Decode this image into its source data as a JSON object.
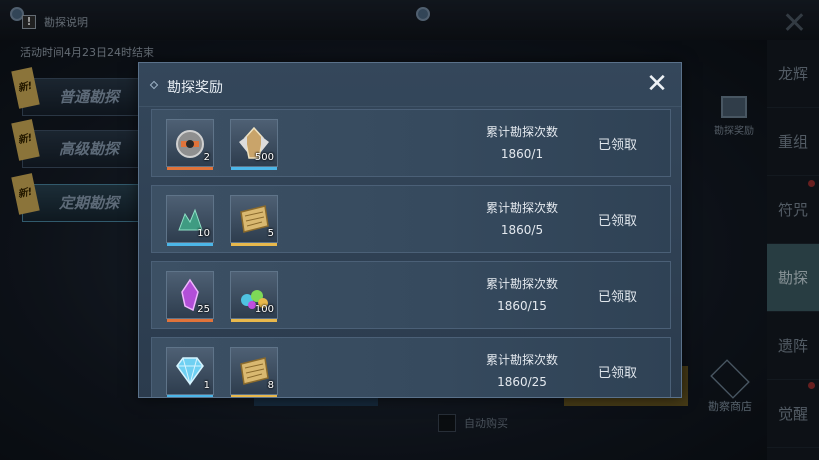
{
  "page": {
    "help_label": "勘探说明",
    "event_time": "活动时间4月23日24时结束",
    "modes": [
      {
        "new_tag": "新!",
        "label": "普通勘探"
      },
      {
        "new_tag": "新!",
        "label": "高级勘探"
      },
      {
        "new_tag": "新!",
        "label": "定期勘探"
      }
    ],
    "side_tabs": [
      "龙辉",
      "重组",
      "符咒",
      "勘探",
      "遗阵",
      "觉醒"
    ],
    "active_side_tab": "勘探",
    "reward_shortcut_label": "勘探奖励",
    "shop_label": "勘察商店",
    "auto_buy_label": "自动购买"
  },
  "modal": {
    "title": "勘探奖励",
    "close_icon": "close-icon",
    "rewards": [
      {
        "items": [
          {
            "icon": "mech-core-icon",
            "qty": "2",
            "rarity_color": "#e0733a"
          },
          {
            "icon": "armor-figure-icon",
            "qty": "500",
            "rarity_color": "#4cb6e8"
          }
        ],
        "condition_label": "累计勘探次数",
        "progress": "1860/1",
        "status": "已领取"
      },
      {
        "items": [
          {
            "icon": "green-crystal-icon",
            "qty": "10",
            "rarity_color": "#4cb6e8"
          },
          {
            "icon": "scroll-icon",
            "qty": "5",
            "rarity_color": "#e8b84c"
          }
        ],
        "condition_label": "累计勘探次数",
        "progress": "1860/5",
        "status": "已领取"
      },
      {
        "items": [
          {
            "icon": "purple-crystal-icon",
            "qty": "25",
            "rarity_color": "#e0733a"
          },
          {
            "icon": "gem-pile-icon",
            "qty": "100",
            "rarity_color": "#e8b84c"
          }
        ],
        "condition_label": "累计勘探次数",
        "progress": "1860/15",
        "status": "已领取"
      },
      {
        "items": [
          {
            "icon": "diamond-icon",
            "qty": "1",
            "rarity_color": "#4cb6e8"
          },
          {
            "icon": "scroll-icon",
            "qty": "8",
            "rarity_color": "#e8b84c"
          }
        ],
        "condition_label": "累计勘探次数",
        "progress": "1860/25",
        "status": "已领取"
      }
    ]
  }
}
